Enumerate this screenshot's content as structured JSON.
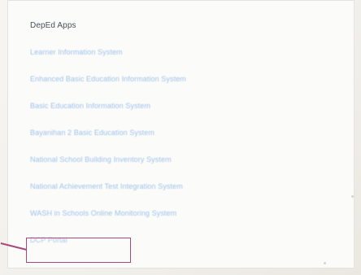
{
  "section": {
    "heading": "DepEd Apps"
  },
  "apps": [
    {
      "label": "Learner Information System"
    },
    {
      "label": "Enhanced Basic Education Information System"
    },
    {
      "label": "Basic Education Information System"
    },
    {
      "label": "Bayanihan 2 Basic Education System"
    },
    {
      "label": "National School Building Inventory System"
    },
    {
      "label": "National Achievement Test Integration System"
    },
    {
      "label": "WASH in Schools Online Monitoring System"
    },
    {
      "label": "DCP Portal"
    }
  ],
  "colors": {
    "link": "#9ec2e8",
    "heading": "#4a4f5a",
    "highlight": "#a8487c"
  }
}
